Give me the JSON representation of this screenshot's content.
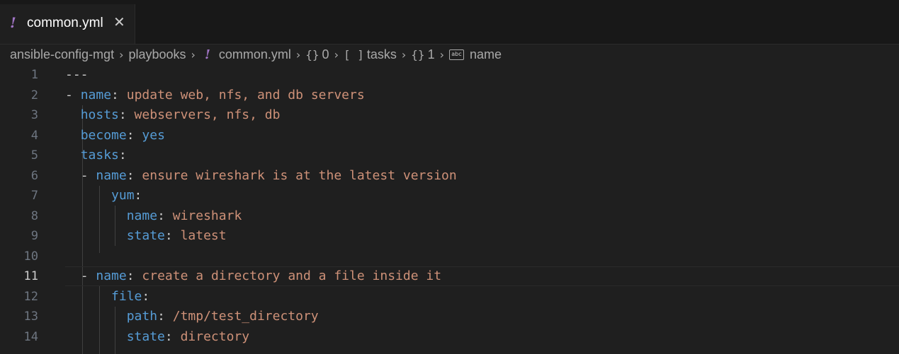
{
  "tab": {
    "icon": "!",
    "title": "common.yml",
    "close": "✕"
  },
  "breadcrumb": {
    "segments": [
      "ansible-config-mgt",
      "playbooks",
      "common.yml",
      "0",
      "tasks",
      "1",
      "name"
    ],
    "separator": "›",
    "symbols": {
      "object": "{}",
      "array": "[ ]",
      "string_icon_text": "abc"
    }
  },
  "editor": {
    "current_line": 11,
    "lines": [
      {
        "n": "1",
        "dash": "",
        "key": "",
        "colon": "",
        "value": "---"
      },
      {
        "n": "2",
        "dash": "- ",
        "key": "name",
        "colon": ":",
        "value": " update web, nfs, and db servers"
      },
      {
        "n": "3",
        "dash": "",
        "key": "hosts",
        "colon": ":",
        "value": " webservers, nfs, db"
      },
      {
        "n": "4",
        "dash": "",
        "key": "become",
        "colon": ":",
        "value": " yes"
      },
      {
        "n": "5",
        "dash": "",
        "key": "tasks",
        "colon": ":",
        "value": ""
      },
      {
        "n": "6",
        "dash": "- ",
        "key": "name",
        "colon": ":",
        "value": " ensure wireshark is at the latest version"
      },
      {
        "n": "7",
        "dash": "",
        "key": "yum",
        "colon": ":",
        "value": ""
      },
      {
        "n": "8",
        "dash": "",
        "key": "name",
        "colon": ":",
        "value": " wireshark"
      },
      {
        "n": "9",
        "dash": "",
        "key": "state",
        "colon": ":",
        "value": " latest"
      },
      {
        "n": "10",
        "dash": "",
        "key": "",
        "colon": "",
        "value": ""
      },
      {
        "n": "11",
        "dash": "- ",
        "key": "name",
        "colon": ":",
        "value": " create a directory and a file inside it"
      },
      {
        "n": "12",
        "dash": "",
        "key": "file",
        "colon": ":",
        "value": ""
      },
      {
        "n": "13",
        "dash": "",
        "key": "path",
        "colon": ":",
        "value": " /tmp/test_directory"
      },
      {
        "n": "14",
        "dash": "",
        "key": "state",
        "colon": ":",
        "value": " directory"
      }
    ]
  },
  "colors": {
    "background": "#1f1f1f",
    "key": "#569cd6",
    "string": "#ce9178",
    "yaml_icon": "#a074c4"
  }
}
